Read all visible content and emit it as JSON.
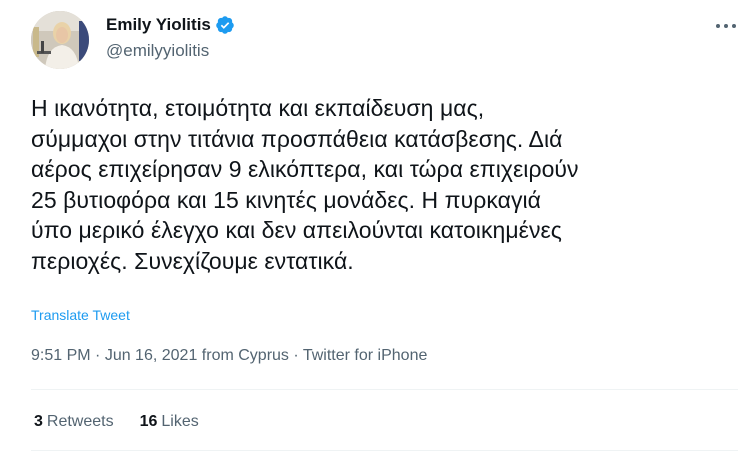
{
  "author": {
    "display_name": "Emily Yiolitis",
    "handle": "@emilyyiolitis",
    "verified": true,
    "verified_color": "#1d9bf0"
  },
  "tweet": {
    "lines": [
      "Η ικανότητα, ετοιμότητα και εκπαίδευση μας,",
      "σύμμαχοι στην τιτάνια προσπάθεια κατάσβεσης. Διά",
      "αέρος επιχείρησαν 9 ελικόπτερα, και τώρα επιχειρούν",
      "25 βυτιοφόρα και 15 κινητές μονάδες. Η πυρκαγιά",
      "ύπο μερικό έλεγχο και δεν απειλούνται κατοικημένες",
      "περιοχές. Συνεχίζουμε εντατικά."
    ],
    "translate_label": "Translate Tweet"
  },
  "meta": {
    "time": "9:51 PM",
    "separator": " · ",
    "date": "Jun 16, 2021",
    "location": "from Cyprus",
    "source": "Twitter for iPhone"
  },
  "stats": {
    "retweets_count": "3",
    "retweets_label": "Retweets",
    "likes_count": "16",
    "likes_label": "Likes"
  },
  "icons": {
    "more": "more-horizontal-icon",
    "verified": "verified-badge-icon"
  }
}
